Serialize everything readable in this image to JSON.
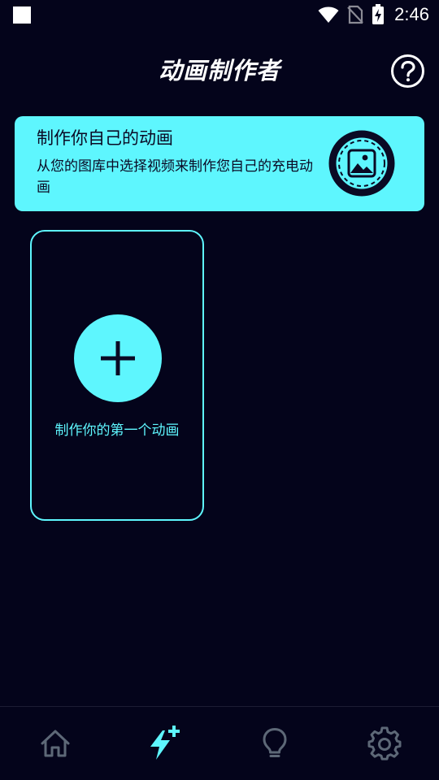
{
  "status_bar": {
    "time": "2:46",
    "icons": [
      "notification-square-icon",
      "wifi-icon",
      "no-sim-icon",
      "battery-charging-icon"
    ]
  },
  "header": {
    "title": "动画制作者",
    "help_icon": "question-circle-icon"
  },
  "banner": {
    "title": "制作你自己的动画",
    "description": "从您的图库中选择视频来制作您自己的充电动画",
    "icon": "image-gallery-icon"
  },
  "create_card": {
    "label": "制作你的第一个动画",
    "icon": "plus-icon"
  },
  "bottom_nav": {
    "items": [
      {
        "icon": "home-icon",
        "active": false
      },
      {
        "icon": "bolt-plus-icon",
        "active": true
      },
      {
        "icon": "lightbulb-icon",
        "active": false
      },
      {
        "icon": "gear-icon",
        "active": false
      }
    ]
  },
  "colors": {
    "background": "#04041b",
    "accent": "#5ef6fe",
    "nav_inactive": "#5d6877",
    "text_dark": "#0a0a24"
  }
}
